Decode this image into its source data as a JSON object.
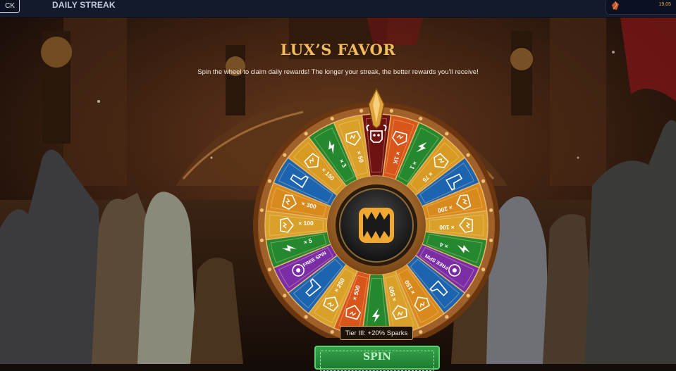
{
  "topbar": {
    "back_label": "CK",
    "title": "DAILY STREAK",
    "resource_value": "19,05",
    "resource_icon": "gem-icon"
  },
  "header": {
    "title": "LUX’S FAVOR",
    "subtitle": "Spin the wheel to claim daily rewards! The longer your streak, the better rewards you’ll receive!"
  },
  "wheel": {
    "segments": [
      {
        "type": "skull",
        "label": "",
        "color": "#6e1212"
      },
      {
        "type": "spark",
        "label": "× 1K",
        "color": "#d8561c"
      },
      {
        "type": "bolt",
        "label": "× 1",
        "color": "#26882e"
      },
      {
        "type": "spark",
        "label": "× 75",
        "color": "#d79a22"
      },
      {
        "type": "boot",
        "label": "",
        "color": "#1d64b0"
      },
      {
        "type": "spark",
        "label": "× 200",
        "color": "#d98a1c"
      },
      {
        "type": "spark",
        "label": "× 100",
        "color": "#d9a02a"
      },
      {
        "type": "bolt",
        "label": "× 4",
        "color": "#26882e"
      },
      {
        "type": "spin",
        "label": "FREE SPIN",
        "color": "#7b2da6"
      },
      {
        "type": "boot",
        "label": "",
        "color": "#1d64b0"
      },
      {
        "type": "spark",
        "label": "× 150",
        "color": "#d98a1c"
      },
      {
        "type": "spark",
        "label": "× 500",
        "color": "#d9a02a"
      },
      {
        "type": "bolt",
        "label": "",
        "color": "#26882e"
      },
      {
        "type": "spark",
        "label": "× 500",
        "color": "#d8561c"
      },
      {
        "type": "spark",
        "label": "× 250",
        "color": "#d9a02a"
      },
      {
        "type": "boot",
        "label": "",
        "color": "#1d64b0"
      },
      {
        "type": "spin",
        "label": "FREE SPIN",
        "color": "#7b2da6"
      },
      {
        "type": "bolt",
        "label": "× 5",
        "color": "#26882e"
      },
      {
        "type": "spark",
        "label": "× 100",
        "color": "#d9a02a"
      },
      {
        "type": "spark",
        "label": "× 300",
        "color": "#d98a1c"
      },
      {
        "type": "boot",
        "label": "",
        "color": "#1d64b0"
      },
      {
        "type": "spark",
        "label": "× 150",
        "color": "#d79a22"
      },
      {
        "type": "bolt",
        "label": "× 3",
        "color": "#26882e"
      },
      {
        "type": "spark",
        "label": "× 50",
        "color": "#d9a02a"
      }
    ],
    "hub_icon": "monster-mouth-icon",
    "pointer_icon": "pointer-icon"
  },
  "tier_badge": "Tier III: +20% Sparks",
  "spin_button": "SPIN",
  "colors": {
    "accent_gold": "#f1bd5c",
    "wheel_rim": "#8a4d1a",
    "spin_green": "#2c9a3f"
  }
}
